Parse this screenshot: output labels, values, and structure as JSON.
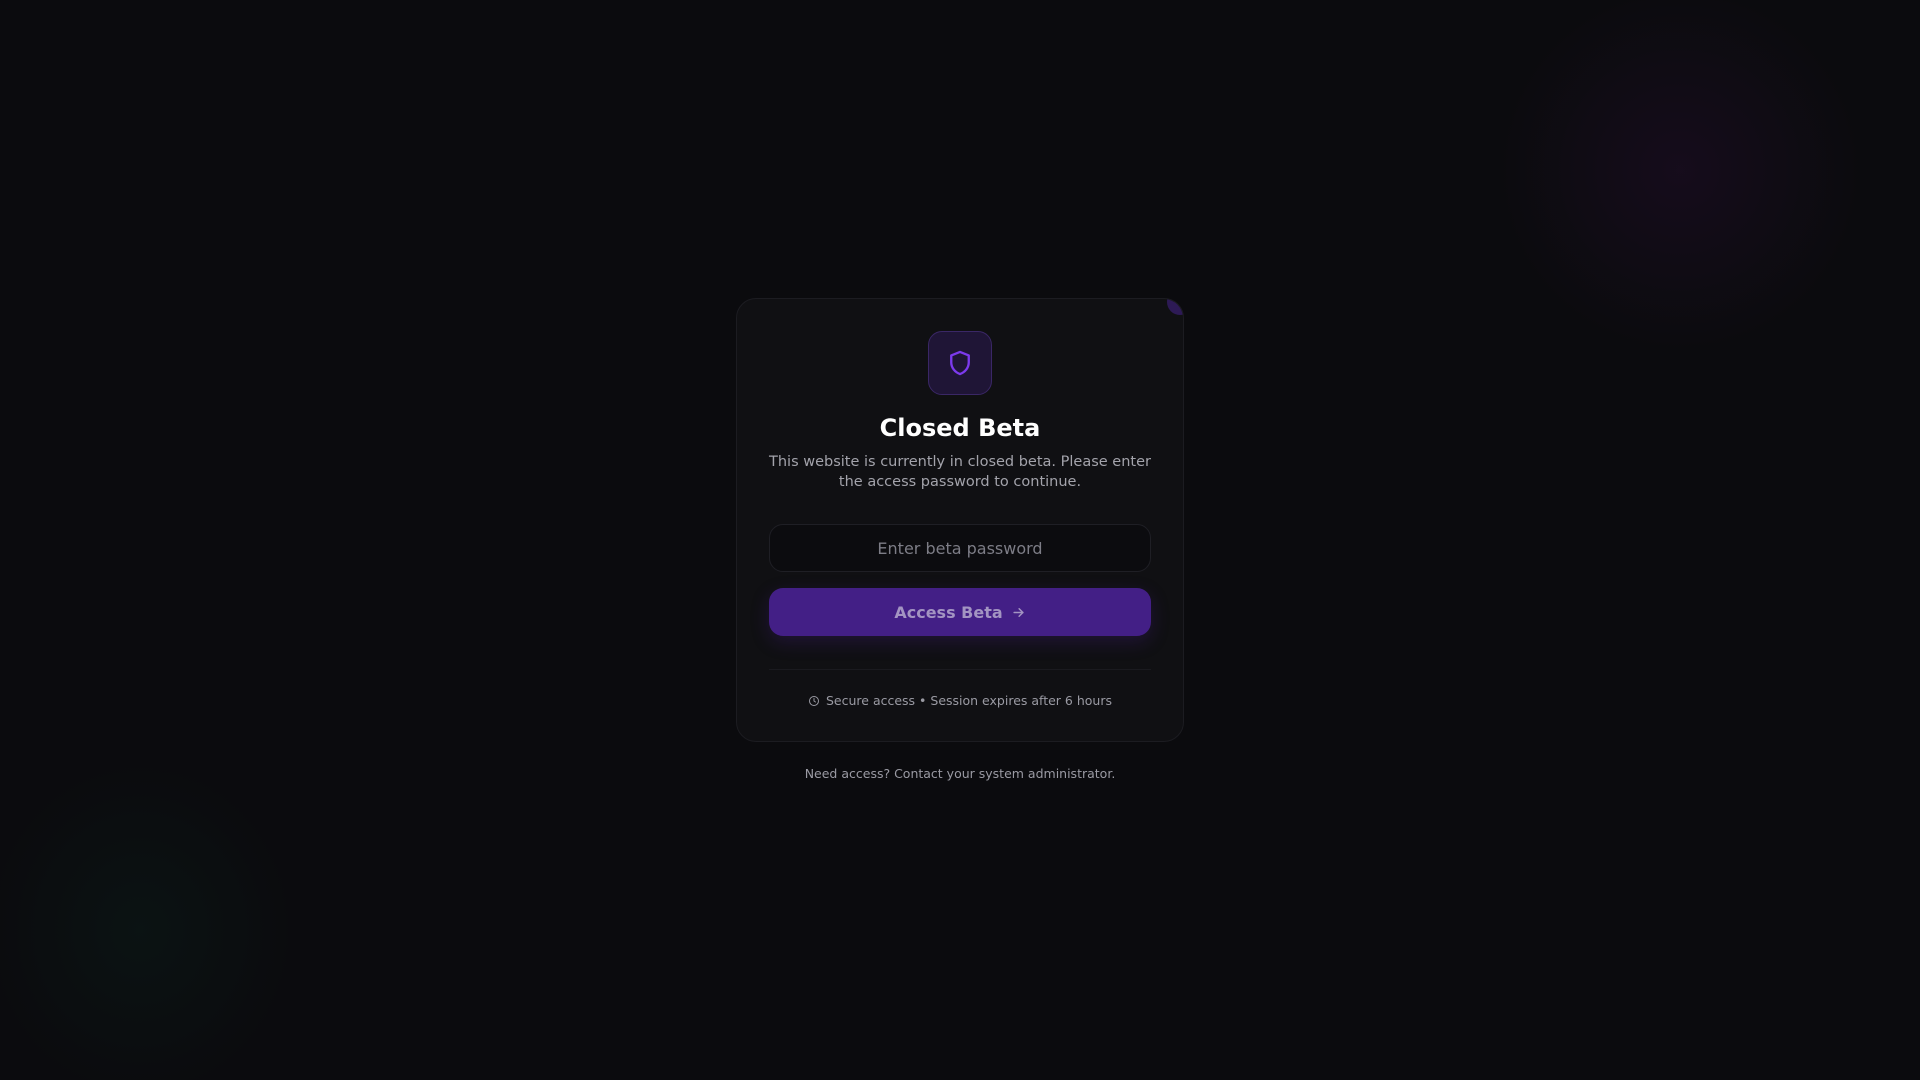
{
  "card": {
    "title": "Closed Beta",
    "subtitle": "This website is currently in closed beta. Please enter the access password to continue.",
    "password": {
      "value": "",
      "placeholder": "Enter beta password"
    },
    "button": {
      "label": "Access Beta",
      "icon": "arrow-right-icon"
    },
    "footer": {
      "icon": "clock-icon",
      "text": "Secure access • Session expires after 6 hours"
    },
    "badge_icon": "shield-icon"
  },
  "help_text": "Need access? Contact your system administrator.",
  "colors": {
    "background": "#0b0b0e",
    "card": "#101013",
    "accent": "#431f86",
    "icon_accent": "#7c3aed"
  }
}
